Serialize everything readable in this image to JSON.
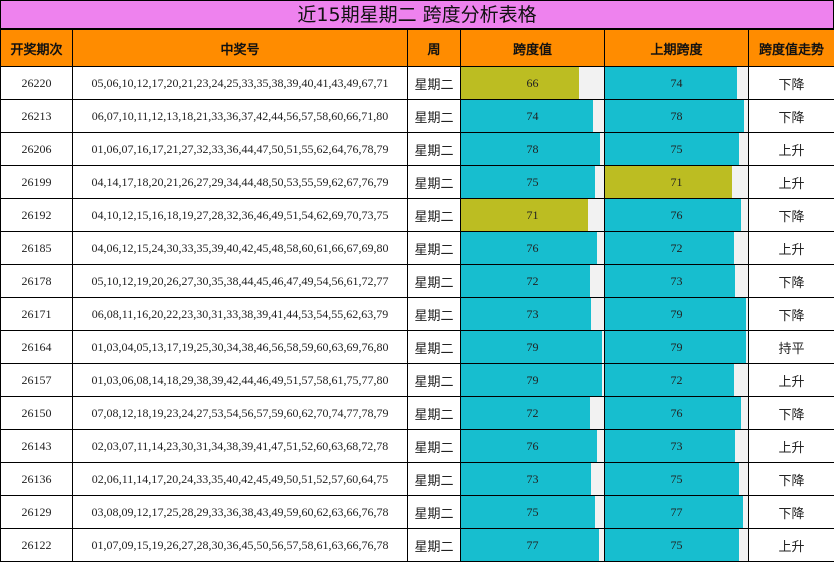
{
  "title": "近15期星期二 跨度分析表格",
  "headers": {
    "period": "开奖期次",
    "numbers": "中奖号",
    "week": "周",
    "span": "跨度值",
    "prev_span": "上期跨度",
    "trend": "跨度值走势"
  },
  "bar_max": 80,
  "colors": {
    "header_bg": "#ff8c00",
    "title_bg": "#ee82ee",
    "bar_cyan": "#17becf",
    "bar_olive": "#bcbd22"
  },
  "rows": [
    {
      "period": "26220",
      "numbers": "05,06,10,12,17,20,21,23,24,25,33,35,38,39,40,41,43,49,67,71",
      "week": "星期二",
      "span": 66,
      "span_text": "66",
      "span_color": "#bcbd22",
      "prev": 74,
      "prev_text": "74",
      "prev_color": "#17becf",
      "trend": "下降"
    },
    {
      "period": "26213",
      "numbers": "06,07,10,11,12,13,18,21,33,36,37,42,44,56,57,58,60,66,71,80",
      "week": "星期二",
      "span": 74,
      "span_text": "74",
      "span_color": "#17becf",
      "prev": 78,
      "prev_text": "78",
      "prev_color": "#17becf",
      "trend": "下降"
    },
    {
      "period": "26206",
      "numbers": "01,06,07,16,17,21,27,32,33,36,44,47,50,51,55,62,64,76,78,79",
      "week": "星期二",
      "span": 78,
      "span_text": "78",
      "span_color": "#17becf",
      "prev": 75,
      "prev_text": "75",
      "prev_color": "#17becf",
      "trend": "上升"
    },
    {
      "period": "26199",
      "numbers": "04,14,17,18,20,21,26,27,29,34,44,48,50,53,55,59,62,67,76,79",
      "week": "星期二",
      "span": 75,
      "span_text": "75",
      "span_color": "#17becf",
      "prev": 71,
      "prev_text": "71",
      "prev_color": "#bcbd22",
      "trend": "上升"
    },
    {
      "period": "26192",
      "numbers": "04,10,12,15,16,18,19,27,28,32,36,46,49,51,54,62,69,70,73,75",
      "week": "星期二",
      "span": 71,
      "span_text": "71",
      "span_color": "#bcbd22",
      "prev": 76,
      "prev_text": "76",
      "prev_color": "#17becf",
      "trend": "下降"
    },
    {
      "period": "26185",
      "numbers": "04,06,12,15,24,30,33,35,39,40,42,45,48,58,60,61,66,67,69,80",
      "week": "星期二",
      "span": 76,
      "span_text": "76",
      "span_color": "#17becf",
      "prev": 72,
      "prev_text": "72",
      "prev_color": "#17becf",
      "trend": "上升"
    },
    {
      "period": "26178",
      "numbers": "05,10,12,19,20,26,27,30,35,38,44,45,46,47,49,54,56,61,72,77",
      "week": "星期二",
      "span": 72,
      "span_text": "72",
      "span_color": "#17becf",
      "prev": 73,
      "prev_text": "73",
      "prev_color": "#17becf",
      "trend": "下降"
    },
    {
      "period": "26171",
      "numbers": "06,08,11,16,20,22,23,30,31,33,38,39,41,44,53,54,55,62,63,79",
      "week": "星期二",
      "span": 73,
      "span_text": "73",
      "span_color": "#17becf",
      "prev": 79,
      "prev_text": "79",
      "prev_color": "#17becf",
      "trend": "下降"
    },
    {
      "period": "26164",
      "numbers": "01,03,04,05,13,17,19,25,30,34,38,46,56,58,59,60,63,69,76,80",
      "week": "星期二",
      "span": 79,
      "span_text": "79",
      "span_color": "#17becf",
      "prev": 79,
      "prev_text": "79",
      "prev_color": "#17becf",
      "trend": "持平"
    },
    {
      "period": "26157",
      "numbers": "01,03,06,08,14,18,29,38,39,42,44,46,49,51,57,58,61,75,77,80",
      "week": "星期二",
      "span": 79,
      "span_text": "79",
      "span_color": "#17becf",
      "prev": 72,
      "prev_text": "72",
      "prev_color": "#17becf",
      "trend": "上升"
    },
    {
      "period": "26150",
      "numbers": "07,08,12,18,19,23,24,27,53,54,56,57,59,60,62,70,74,77,78,79",
      "week": "星期二",
      "span": 72,
      "span_text": "72",
      "span_color": "#17becf",
      "prev": 76,
      "prev_text": "76",
      "prev_color": "#17becf",
      "trend": "下降"
    },
    {
      "period": "26143",
      "numbers": "02,03,07,11,14,23,30,31,34,38,39,41,47,51,52,60,63,68,72,78",
      "week": "星期二",
      "span": 76,
      "span_text": "76",
      "span_color": "#17becf",
      "prev": 73,
      "prev_text": "73",
      "prev_color": "#17becf",
      "trend": "上升"
    },
    {
      "period": "26136",
      "numbers": "02,06,11,14,17,20,24,33,35,40,42,45,49,50,51,52,57,60,64,75",
      "week": "星期二",
      "span": 73,
      "span_text": "73",
      "span_color": "#17becf",
      "prev": 75,
      "prev_text": "75",
      "prev_color": "#17becf",
      "trend": "下降"
    },
    {
      "period": "26129",
      "numbers": "03,08,09,12,17,25,28,29,33,36,38,43,49,59,60,62,63,66,76,78",
      "week": "星期二",
      "span": 75,
      "span_text": "75",
      "span_color": "#17becf",
      "prev": 77,
      "prev_text": "77",
      "prev_color": "#17becf",
      "trend": "下降"
    },
    {
      "period": "26122",
      "numbers": "01,07,09,15,19,26,27,28,30,36,45,50,56,57,58,61,63,66,76,78",
      "week": "星期二",
      "span": 77,
      "span_text": "77",
      "span_color": "#17becf",
      "prev": 75,
      "prev_text": "75",
      "prev_color": "#17becf",
      "trend": "上升"
    }
  ]
}
